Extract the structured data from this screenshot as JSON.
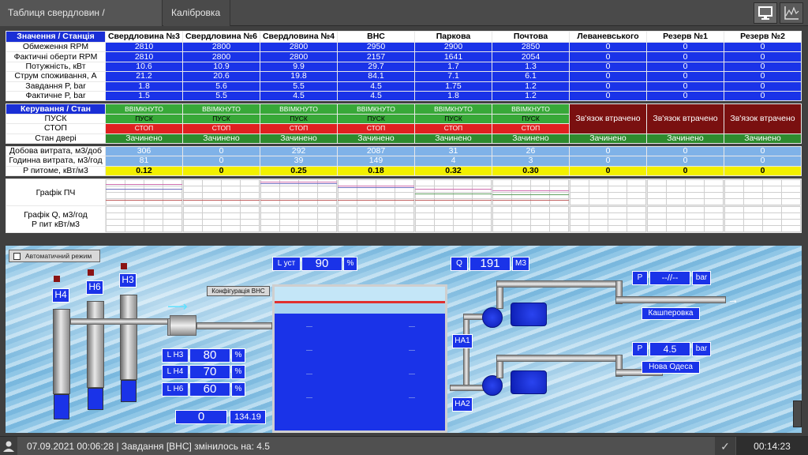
{
  "tabs": [
    "Таблиця свердловин / Мнемосхема",
    "Калібровка"
  ],
  "toolbar": {
    "mnemo_icon": "monitor-icon",
    "chart_icon": "chart-icon"
  },
  "table": {
    "header_label": "Значення / Станція",
    "stations": [
      "Свердловина №3",
      "Свердловина №6",
      "Свердловина №4",
      "ВНС",
      "Паркова",
      "Почтова",
      "Леваневського",
      "Резерв  №1",
      "Резерв №2"
    ],
    "value_rows": [
      {
        "label": "Обмеження RPM",
        "values": [
          "2810",
          "2800",
          "2800",
          "2950",
          "2900",
          "2850",
          "0",
          "0",
          "0"
        ]
      },
      {
        "label": "Фактичні оберти RPM",
        "values": [
          "2810",
          "2800",
          "2800",
          "2157",
          "1641",
          "2054",
          "0",
          "0",
          "0"
        ]
      },
      {
        "label": "Потужність, кВт",
        "values": [
          "10.6",
          "10.9",
          "9.9",
          "29.7",
          "1.7",
          "1.3",
          "0",
          "0",
          "0"
        ]
      },
      {
        "label": "Струм споживання, А",
        "values": [
          "21.2",
          "20.6",
          "19.8",
          "84.1",
          "7.1",
          "6.1",
          "0",
          "0",
          "0"
        ]
      },
      {
        "label": "Завдання P, bar",
        "values": [
          "1.8",
          "5.6",
          "5.5",
          "4.5",
          "1.75",
          "1.2",
          "0",
          "0",
          "0"
        ]
      },
      {
        "label": "Фактичне P, bar",
        "values": [
          "1.5",
          "5.5",
          "4.5",
          "4.5",
          "1.8",
          "1.2",
          "0",
          "0",
          "0"
        ]
      }
    ],
    "control_label": "Керування / Стан",
    "on_label": "ВВІМКНУТО",
    "start_row_label": "ПУСК",
    "start_btn": "ПУСК",
    "stop_row_label": "СТОП",
    "stop_btn": "СТОП",
    "lost_label": "Зв'язок втрачено",
    "door_label": "Стан двері",
    "door_value": "Зачинено",
    "flow_rows": [
      {
        "label": "Добова витрата, м3/доб",
        "values": [
          "306",
          "0",
          "292",
          "2087",
          "31",
          "26",
          "0",
          "0",
          "0"
        ]
      },
      {
        "label": "Годинна витрата, м3/год",
        "values": [
          "81",
          "0",
          "39",
          "149",
          "4",
          "3",
          "0",
          "0",
          "0"
        ]
      }
    ],
    "specific_row": {
      "label": "P питоме, кВт/м3",
      "values": [
        "0.12",
        "0",
        "0.25",
        "0.18",
        "0.32",
        "0.30",
        "0",
        "0",
        "0"
      ]
    },
    "graph_pch_label": "Графік ПЧ",
    "graph_q_label_1": "Графік Q, м3/год",
    "graph_q_label_2": "P пит кВт/м3"
  },
  "scheme": {
    "auto_mode": "Автоматичний режим",
    "config_btn": "Конфігурація ВНС",
    "wells": [
      "Н4",
      "Н6",
      "Н3"
    ],
    "level_label": "L уст",
    "level_value": "90",
    "level_unit": "%",
    "q_label": "Q",
    "q_value": "191",
    "q_unit": "М3",
    "levels": [
      {
        "label": "L Н3",
        "value": "80",
        "unit": "%"
      },
      {
        "label": "L Н4",
        "value": "70",
        "unit": "%"
      },
      {
        "label": "L Н6",
        "value": "60",
        "unit": "%"
      }
    ],
    "counter_1": "0",
    "counter_2": "134.19",
    "pumps": [
      "НА1",
      "НА2"
    ],
    "outlets": [
      {
        "p_label": "P",
        "p_value": "--//--",
        "unit": "bar",
        "name": "Кашперовка"
      },
      {
        "p_label": "P",
        "p_value": "4.5",
        "unit": "bar",
        "name": "Нова Одеса"
      }
    ]
  },
  "status": {
    "message": "07.09.2021  00:06:28 |  Завдання [ВНС] змінилось на: 4.5",
    "clock": "00:14:23"
  }
}
